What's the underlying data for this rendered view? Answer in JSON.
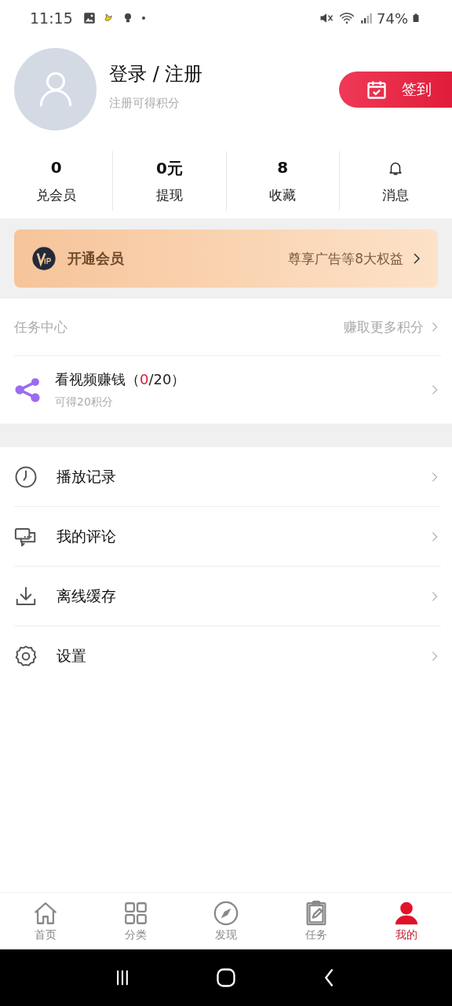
{
  "status_bar": {
    "time": "11:15",
    "battery": "74%"
  },
  "profile": {
    "title": "登录 / 注册",
    "subtitle": "注册可得积分",
    "checkin_button": "签到"
  },
  "stats": [
    {
      "kind": "text",
      "value": "0",
      "label": "兑会员"
    },
    {
      "kind": "text",
      "value": "0元",
      "label": "提现"
    },
    {
      "kind": "text",
      "value": "8",
      "label": "收藏"
    },
    {
      "kind": "bell",
      "label": "消息"
    }
  ],
  "vip_banner": {
    "title": "开通会员",
    "benefits": "尊享广告等8大权益"
  },
  "task_center": {
    "title": "任务中心",
    "more": "赚取更多积分",
    "tasks": [
      {
        "title_before": "看视频赚钱（",
        "done": "0",
        "title_after": "/20）",
        "reward": "可得20积分"
      }
    ]
  },
  "menu": [
    {
      "kind": "history",
      "label": "播放记录"
    },
    {
      "kind": "comments",
      "label": "我的评论"
    },
    {
      "kind": "download",
      "label": "离线缓存"
    },
    {
      "kind": "settings",
      "label": "设置"
    }
  ],
  "bottom_nav": [
    {
      "kind": "home",
      "label": "首页",
      "selected": false
    },
    {
      "kind": "grid",
      "label": "分类",
      "selected": false
    },
    {
      "kind": "compass",
      "label": "发现",
      "selected": false
    },
    {
      "kind": "clipboard",
      "label": "任务",
      "selected": false
    },
    {
      "kind": "person",
      "label": "我的",
      "selected": true
    }
  ]
}
